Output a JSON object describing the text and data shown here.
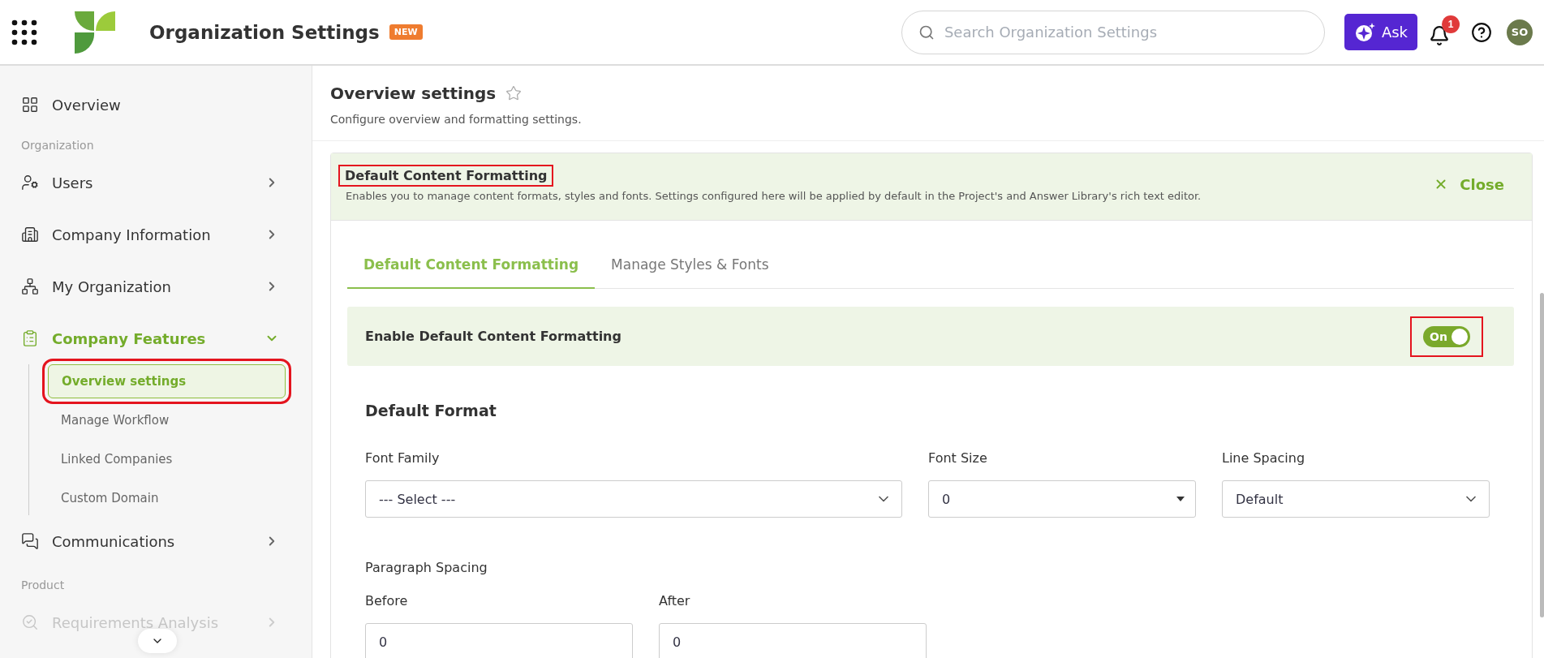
{
  "header": {
    "title": "Organization Settings",
    "badge": "NEW",
    "search": {
      "placeholder": "Search Organization Settings"
    },
    "ask_button": "Ask",
    "notification_count": "1",
    "avatar": "SO"
  },
  "sidebar": {
    "items": [
      {
        "kind": "link",
        "label": "Overview"
      },
      {
        "kind": "section",
        "label": "Organization"
      },
      {
        "kind": "group",
        "label": "Users",
        "expanded": false,
        "active": false,
        "disabled": false
      },
      {
        "kind": "group",
        "label": "Company Information",
        "expanded": false,
        "active": false,
        "disabled": false
      },
      {
        "kind": "group",
        "label": "My Organization",
        "expanded": false,
        "active": false,
        "disabled": false
      },
      {
        "kind": "group",
        "label": "Company Features",
        "expanded": true,
        "active": true,
        "disabled": false,
        "children": [
          {
            "label": "Overview settings",
            "selected": true,
            "highlighted": true
          },
          {
            "label": "Manage Workflow",
            "selected": false,
            "highlighted": false
          },
          {
            "label": "Linked Companies",
            "selected": false,
            "highlighted": false
          },
          {
            "label": "Custom Domain",
            "selected": false,
            "highlighted": false
          }
        ]
      },
      {
        "kind": "group",
        "label": "Communications",
        "expanded": false,
        "active": false,
        "disabled": false
      },
      {
        "kind": "section",
        "label": "Product"
      },
      {
        "kind": "group",
        "label": "Requirements Analysis",
        "expanded": false,
        "active": false,
        "disabled": true
      }
    ]
  },
  "page": {
    "title": "Overview settings",
    "subtitle": "Configure overview and formatting settings."
  },
  "panel": {
    "title": "Default Content Formatting",
    "highlighted": true,
    "description": "Enables you to manage content formats, styles and fonts. Settings configured here will be applied by default in the Project's and Answer Library's rich text editor.",
    "close": "Close",
    "tabs": [
      {
        "label": "Default Content Formatting",
        "selected": true
      },
      {
        "label": "Manage Styles & Fonts",
        "selected": false
      }
    ],
    "enable": {
      "label": "Enable Default Content Formatting",
      "on": true,
      "toggle_text": "On",
      "highlighted": true
    },
    "section_title": "Default Format",
    "fields": [
      {
        "kind": "select",
        "label": "Font Family",
        "value": "--- Select ---"
      },
      {
        "kind": "dropdown",
        "label": "Font Size",
        "value": "0"
      },
      {
        "kind": "select",
        "label": "Line Spacing",
        "value": "Default"
      }
    ],
    "paragraph": {
      "title": "Paragraph Spacing",
      "fields": [
        {
          "label": "Before",
          "value": "0"
        },
        {
          "label": "After",
          "value": "0"
        }
      ]
    }
  }
}
